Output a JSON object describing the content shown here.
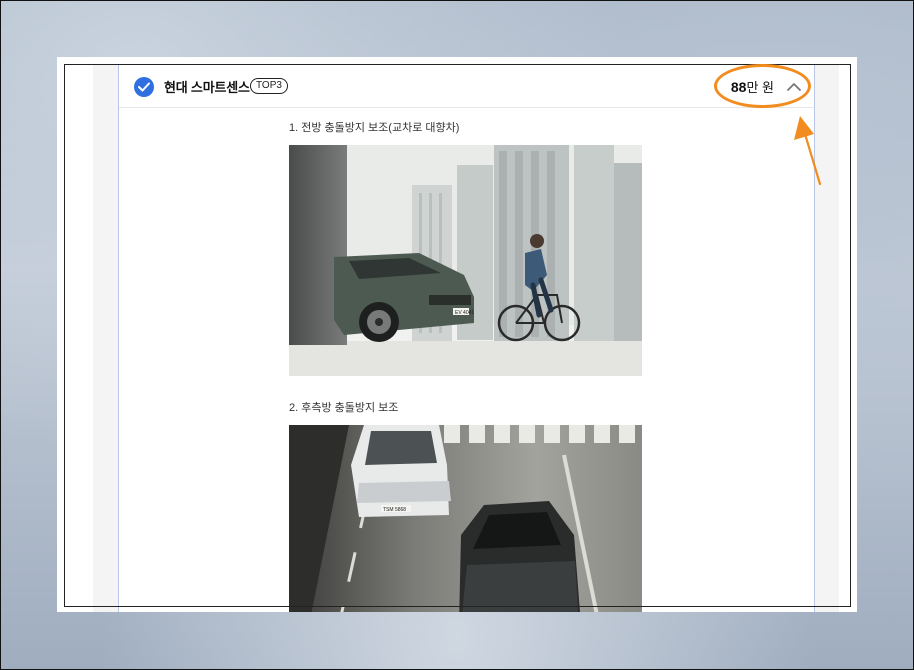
{
  "header": {
    "title": "현대 스마트센스",
    "badge": "TOP3",
    "price_number": "88",
    "price_unit": "만 원"
  },
  "items": [
    {
      "label": "1. 전방 충돌방지 보조(교차로 대향차)"
    },
    {
      "label": "2. 후측방 충돌방지 보조"
    }
  ],
  "photo1_plate": "EV 4041",
  "photo2_plate": "TSM 5868",
  "colors": {
    "accent_blue": "#2f6fdf",
    "highlight_orange": "#f28c1f"
  },
  "icons": [
    "check-circle-icon",
    "chevron-up-icon",
    "arrow-icon"
  ]
}
